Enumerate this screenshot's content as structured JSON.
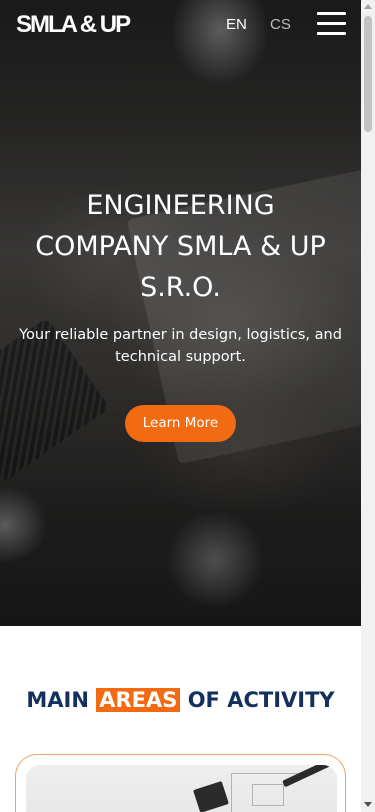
{
  "header": {
    "logo": "SMLA & UP",
    "languages": [
      "EN",
      "CS"
    ],
    "menu_icon": "hamburger-menu-icon"
  },
  "hero": {
    "title": "ENGINEERING COMPANY SMLA & UP S.R.O.",
    "subtitle": "Your reliable partner in design, logistics, and technical support.",
    "cta_label": "Learn More"
  },
  "section": {
    "title_before": "MAIN",
    "title_highlight": "AREAS",
    "title_after": "OF ACTIVITY"
  },
  "colors": {
    "accent": "#f26a12",
    "heading_navy": "#13315c",
    "card_border": "#f0a069"
  }
}
